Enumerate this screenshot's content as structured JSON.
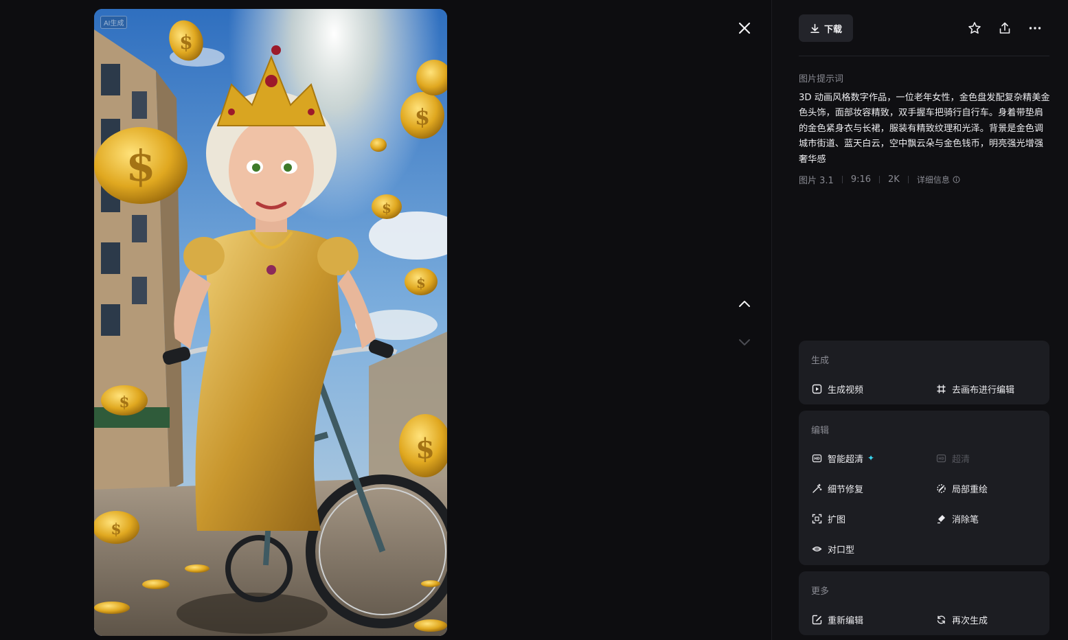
{
  "image": {
    "badge": "AI生成"
  },
  "toolbar": {
    "download_label": "下载"
  },
  "prompt": {
    "label": "图片提示词",
    "text": "3D 动画风格数字作品，一位老年女性，金色盘发配复杂精美金色头饰，面部妆容精致，双手握车把骑行自行车。身着带垫肩的金色紧身衣与长裙，服装有精致纹理和光泽。背景是金色调城市街道、蓝天白云，空中飘云朵与金色钱币，明亮强光增强奢华感"
  },
  "meta": {
    "model": "图片 3.1",
    "ratio": "9:16",
    "resolution": "2K",
    "detail_label": "详细信息"
  },
  "generate": {
    "title": "生成",
    "items": [
      "生成视频",
      "去画布进行编辑"
    ]
  },
  "edit": {
    "title": "编辑",
    "items": [
      "智能超清",
      "超清",
      "细节修复",
      "局部重绘",
      "扩图",
      "消除笔",
      "对口型"
    ]
  },
  "more": {
    "title": "更多",
    "items": [
      "重新编辑",
      "再次生成"
    ]
  },
  "colors": {
    "background": "#0d0d10",
    "card": "#1c1d22",
    "button": "#23242a",
    "accent_sparkle": "#3ad6f0",
    "muted_text": "#8a8b93"
  }
}
